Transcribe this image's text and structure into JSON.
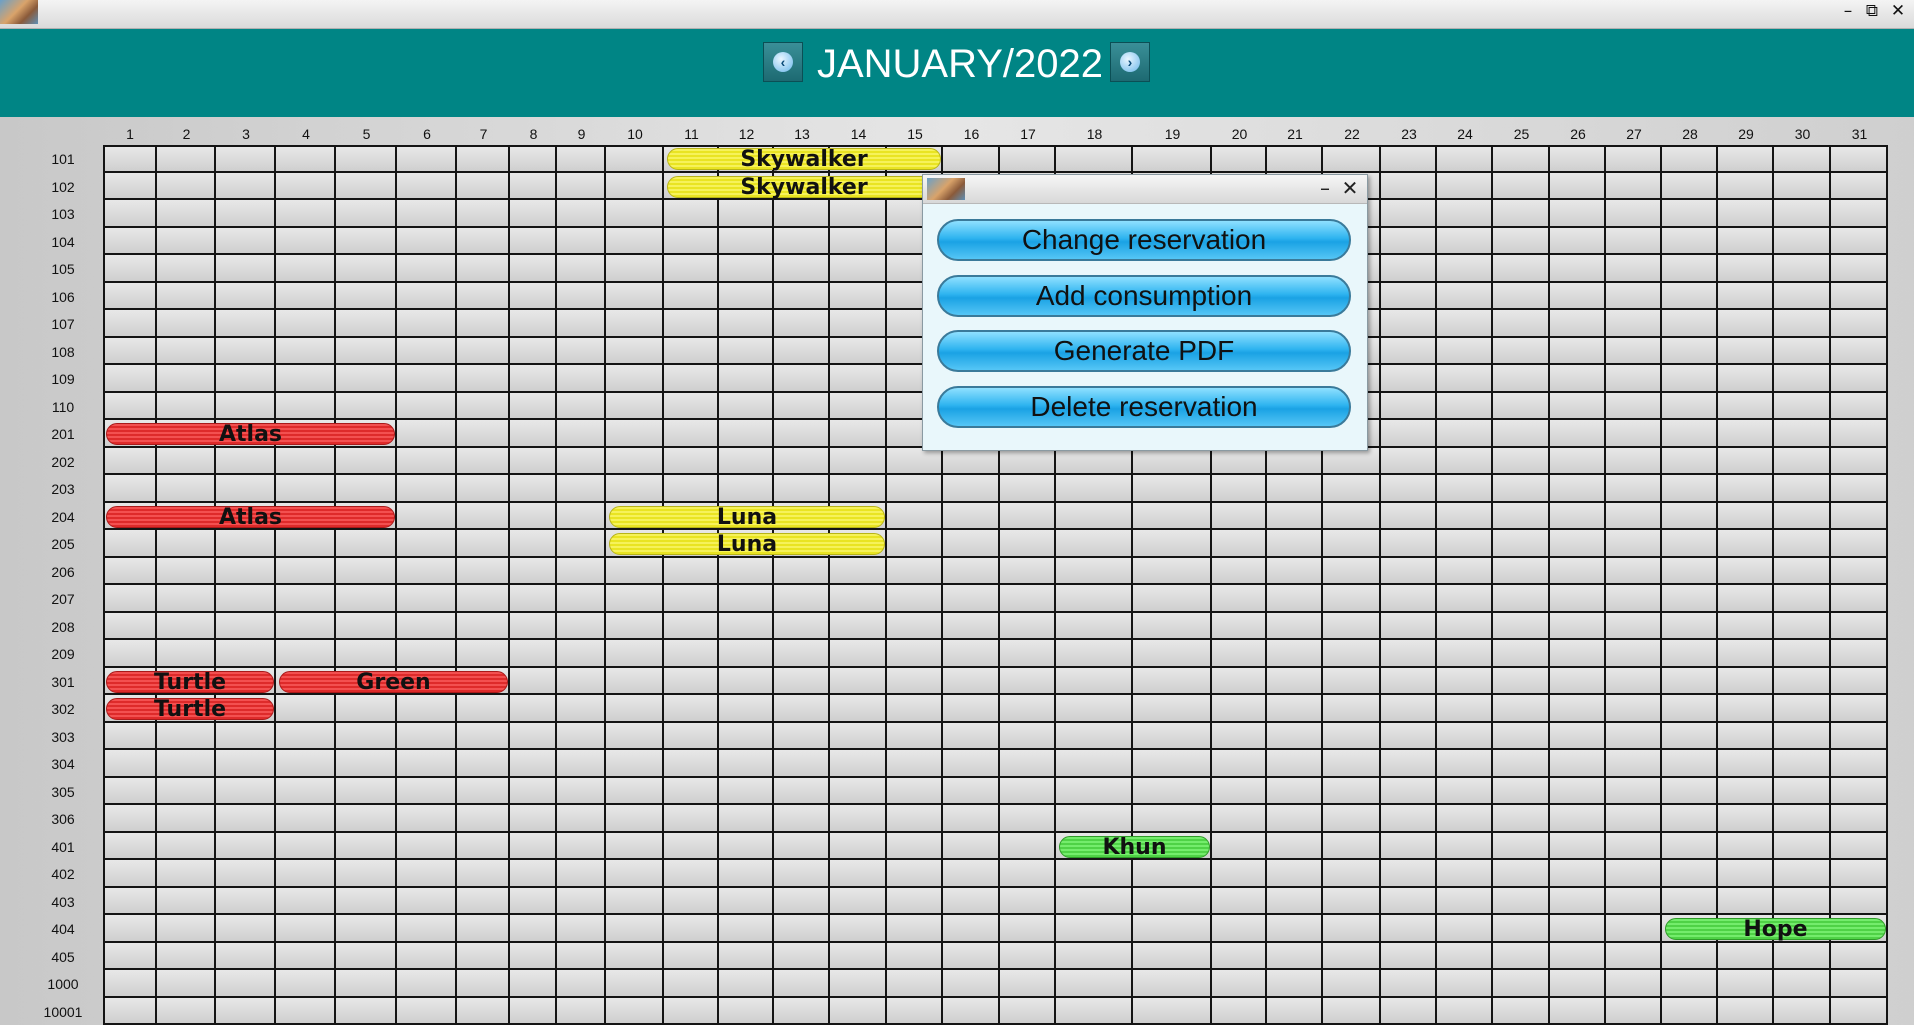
{
  "window": {
    "minimize": "–",
    "maximize": "⧉",
    "close": "✕"
  },
  "header": {
    "title": "JANUARY/2022",
    "prev_icon": "arrow-left-icon",
    "next_icon": "arrow-right-icon"
  },
  "days": [
    "1",
    "2",
    "3",
    "4",
    "5",
    "6",
    "7",
    "8",
    "9",
    "10",
    "11",
    "12",
    "13",
    "14",
    "15",
    "16",
    "17",
    "18",
    "19",
    "20",
    "21",
    "22",
    "23",
    "24",
    "25",
    "26",
    "27",
    "28",
    "29",
    "30",
    "31"
  ],
  "rooms": [
    "101",
    "102",
    "103",
    "104",
    "105",
    "106",
    "107",
    "108",
    "109",
    "110",
    "201",
    "202",
    "203",
    "204",
    "205",
    "206",
    "207",
    "208",
    "209",
    "301",
    "302",
    "303",
    "304",
    "305",
    "306",
    "401",
    "402",
    "403",
    "404",
    "405",
    "1000",
    "10001"
  ],
  "reservations": [
    {
      "name": "Skywalker",
      "room": "101",
      "start": 11,
      "end": 15,
      "color": "yellow"
    },
    {
      "name": "Skywalker",
      "room": "102",
      "start": 11,
      "end": 15,
      "color": "yellow"
    },
    {
      "name": "Atlas",
      "room": "201",
      "start": 1,
      "end": 5,
      "color": "red"
    },
    {
      "name": "Atlas",
      "room": "204",
      "start": 1,
      "end": 5,
      "color": "red"
    },
    {
      "name": "Luna",
      "room": "204",
      "start": 10,
      "end": 14,
      "color": "yellow"
    },
    {
      "name": "Luna",
      "room": "205",
      "start": 10,
      "end": 14,
      "color": "yellow"
    },
    {
      "name": "Turtle",
      "room": "301",
      "start": 1,
      "end": 3,
      "color": "red"
    },
    {
      "name": "Green",
      "room": "301",
      "start": 4,
      "end": 7,
      "color": "red"
    },
    {
      "name": "Turtle",
      "room": "302",
      "start": 1,
      "end": 3,
      "color": "red"
    },
    {
      "name": "Khun",
      "room": "401",
      "start": 18,
      "end": 19,
      "color": "green"
    },
    {
      "name": "Hope",
      "room": "404",
      "start": 28,
      "end": 31,
      "color": "green"
    }
  ],
  "colors": {
    "yellow": "#ece83a",
    "red": "#e83a3a",
    "green": "#5ddc54",
    "header": "#008585",
    "button": "#2fb4f0"
  },
  "popup": {
    "minimize": "–",
    "close": "✕",
    "actions": [
      {
        "label": "Change reservation"
      },
      {
        "label": "Add consumption"
      },
      {
        "label": "Generate PDF"
      },
      {
        "label": "Delete reservation"
      }
    ]
  }
}
